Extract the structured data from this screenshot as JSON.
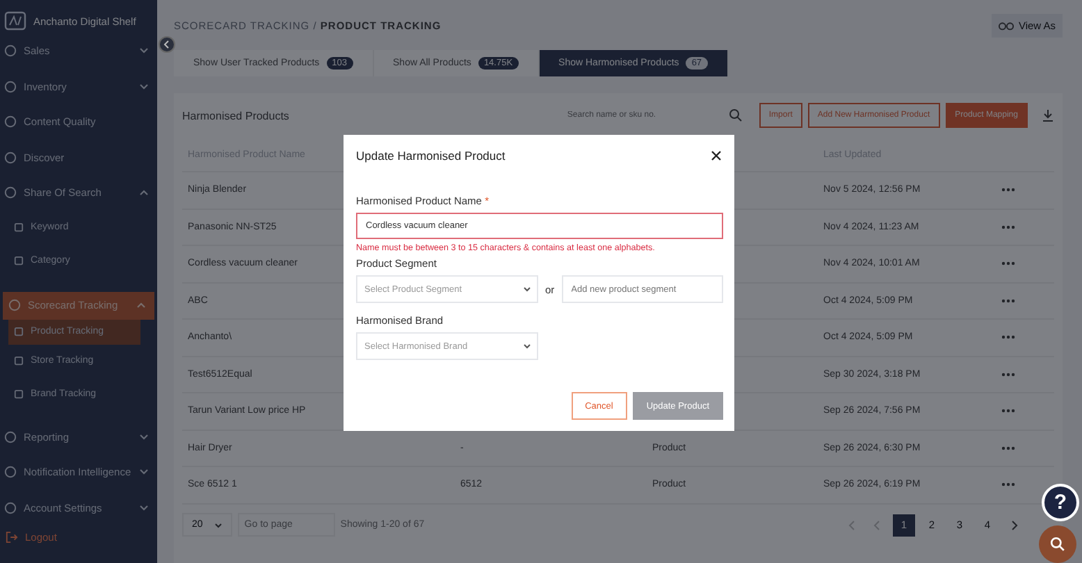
{
  "brand": {
    "name": "Anchanto Digital Shelf"
  },
  "sidebar": {
    "items": [
      {
        "label": "Sales",
        "expanded": false,
        "selected": false
      },
      {
        "label": "Inventory",
        "expanded": false,
        "selected": false
      },
      {
        "label": "Content Quality",
        "selected": false
      },
      {
        "label": "Discover",
        "selected": false
      },
      {
        "label": "Share Of Search",
        "expanded": true,
        "selected": false,
        "children": [
          {
            "label": "Keyword",
            "selected": false
          },
          {
            "label": "Category",
            "selected": false
          }
        ]
      },
      {
        "label": "Scorecard Tracking",
        "expanded": true,
        "selected": true,
        "children": [
          {
            "label": "Product Tracking",
            "selected": true
          },
          {
            "label": "Store Tracking",
            "selected": false
          },
          {
            "label": "Brand Tracking",
            "selected": false
          }
        ]
      },
      {
        "label": "Reporting",
        "expanded": false,
        "selected": false
      },
      {
        "label": "Notification Intelligence",
        "expanded": false,
        "selected": false
      },
      {
        "label": "Account Settings",
        "expanded": false,
        "selected": false
      }
    ],
    "logout": "Logout"
  },
  "breadcrumb": {
    "parent": "SCORECARD TRACKING",
    "separator": "/",
    "current": "PRODUCT TRACKING"
  },
  "view_as": "View As",
  "tabs": [
    {
      "label": "Show User Tracked Products",
      "count": "103",
      "selected": false
    },
    {
      "label": "Show All Products",
      "count": "14.75K",
      "selected": false
    },
    {
      "label": "Show Harmonised Products",
      "count": "67",
      "selected": true
    }
  ],
  "toolbar": {
    "title": "Harmonised Products",
    "search": {
      "placeholder": "Search name or sku no."
    },
    "buttons": [
      {
        "label": "Import",
        "kind": "outline"
      },
      {
        "label": "Add New Harmonised Product",
        "kind": "outline"
      },
      {
        "label": "Product Mapping",
        "kind": "primary"
      }
    ]
  },
  "table": {
    "header": {
      "name": "Harmonised Product Name",
      "last_updated": "Last Updated"
    },
    "rows": [
      {
        "name": "Ninja Blender",
        "last_updated": "Nov 5 2024, 12:56 PM"
      },
      {
        "name": "Panasonic NN-ST25",
        "last_updated": "Nov 4 2024, 11:23 AM"
      },
      {
        "name": "Cordless vacuum cleaner",
        "last_updated": "Nov 4 2024, 10:01 AM"
      },
      {
        "name": "ABC",
        "last_updated": "Oct 4 2024, 5:09 PM"
      },
      {
        "name": "Anchanto\\",
        "last_updated": "Oct 4 2024, 5:09 PM"
      },
      {
        "name": "Test6512Equal",
        "last_updated": "Sep 30 2024, 3:18 PM"
      },
      {
        "name": "Tarun Variant Low price HP",
        "last_updated": "Sep 26 2024, 7:56 PM"
      },
      {
        "name": "Hair Dryer",
        "column_2": "-",
        "column_3": "Product",
        "last_updated": "Sep 26 2024, 6:30 PM"
      },
      {
        "name": "Sce 6512 1",
        "column_2": "6512",
        "column_3": "Product",
        "last_updated": "Sep 26 2024, 6:19 PM"
      }
    ]
  },
  "pagination": {
    "page_size": "20",
    "go_to": {
      "placeholder": "Go to page"
    },
    "summary": "Showing 1-20 of 67",
    "pages": [
      {
        "label": "1",
        "selected": true
      },
      {
        "label": "2",
        "selected": false
      },
      {
        "label": "3",
        "selected": false
      },
      {
        "label": "4",
        "selected": false
      }
    ]
  },
  "help_button": "?",
  "modal": {
    "title": "Update Harmonised Product",
    "name_field": {
      "label": "Harmonised Product Name",
      "required": "*",
      "value": "Cordless vacuum cleaner",
      "error": "Name must be between 3 to 15 characters & contains at least one alphabets."
    },
    "segment": {
      "label": "Product Segment",
      "select_placeholder": "Select Product Segment",
      "or": "or",
      "input_placeholder": "Add new product segment"
    },
    "brand": {
      "label": "Harmonised Brand",
      "select_placeholder": "Select Harmonised Brand"
    },
    "buttons": [
      {
        "label": "Cancel",
        "kind": "outline",
        "disabled": false
      },
      {
        "label": "Update Product",
        "kind": "primary",
        "disabled": true
      }
    ]
  }
}
